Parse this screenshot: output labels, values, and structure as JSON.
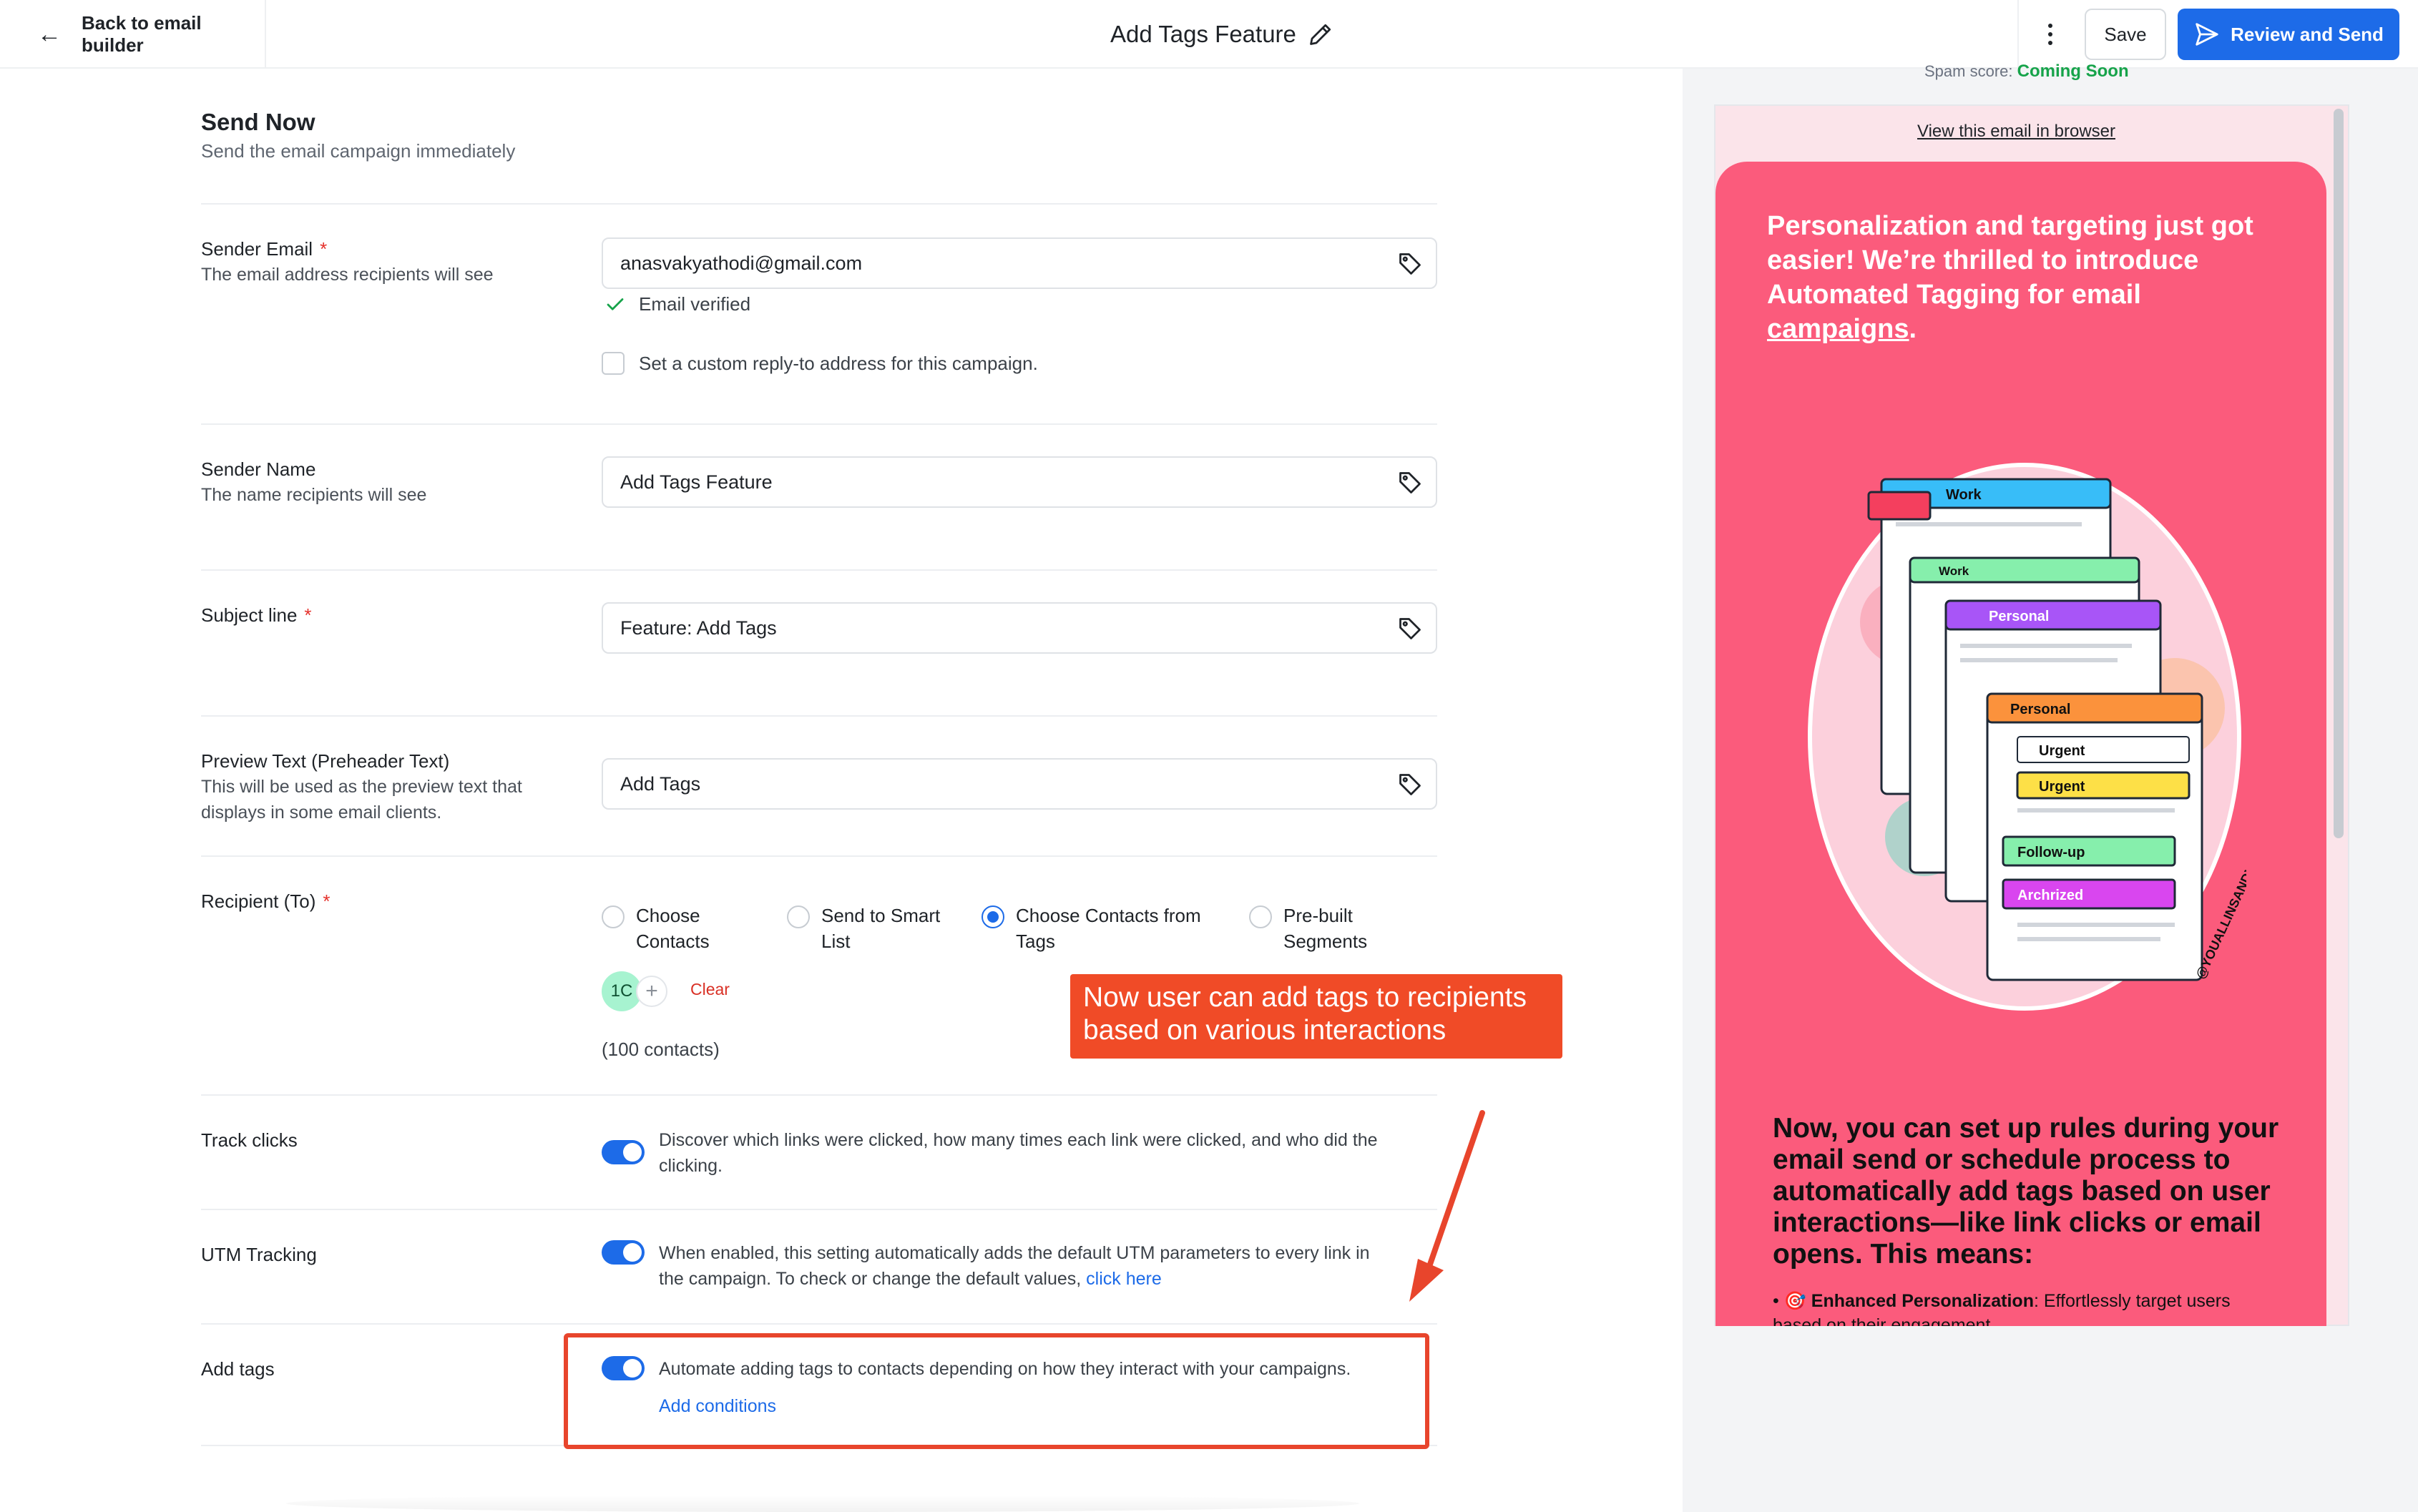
{
  "topbar": {
    "back_label": "Back to email builder",
    "title": "Add Tags Feature",
    "save_label": "Save",
    "review_label": "Review and Send"
  },
  "send_now": {
    "title": "Send Now",
    "subtitle": "Send the email campaign immediately"
  },
  "sender_email": {
    "label": "Sender Email",
    "required_mark": "*",
    "help": "The email address recipients will see",
    "value": "anasvakyathodi@gmail.com",
    "verified_text": "Email verified",
    "reply_to_label": "Set a custom reply-to address for this campaign."
  },
  "sender_name": {
    "label": "Sender Name",
    "help": "The name recipients will see",
    "value": "Add Tags Feature"
  },
  "subject": {
    "label": "Subject line",
    "required_mark": "*",
    "value": "Feature: Add Tags"
  },
  "preview_text": {
    "label": "Preview Text (Preheader Text)",
    "help_line1": "This will be used as the preview text that",
    "help_line2": "displays in some email clients.",
    "value": "Add Tags"
  },
  "recipient": {
    "label": "Recipient (To)",
    "required_mark": "*",
    "options": [
      {
        "line1": "Choose",
        "line2": "Contacts",
        "selected": false
      },
      {
        "line1": "Send to Smart",
        "line2": "List",
        "selected": false
      },
      {
        "line1": "Choose Contacts from",
        "line2": "Tags",
        "selected": true
      },
      {
        "line1": "Pre-built",
        "line2": "Segments",
        "selected": false
      }
    ],
    "chip": "1C",
    "add_symbol": "+",
    "clear_label": "Clear",
    "count": "(100 contacts)"
  },
  "track_clicks": {
    "label": "Track clicks",
    "enabled": true,
    "desc_line1": "Discover which links were clicked, how many times each link were clicked, and who did the",
    "desc_line2": "clicking."
  },
  "utm": {
    "label": "UTM Tracking",
    "enabled": true,
    "desc_line1": "When enabled, this setting automatically adds the default UTM parameters to every link in",
    "desc_line2": "the campaign. To check or change the default values,",
    "link": "click here"
  },
  "add_tags": {
    "label": "Add tags",
    "enabled": true,
    "desc": "Automate adding tags to contacts depending on how they interact with your campaigns.",
    "link": "Add conditions"
  },
  "annotation": {
    "line1": "Now user can add tags to recipients",
    "line2": "based on various interactions"
  },
  "preview": {
    "spam_label": "Spam score:",
    "spam_value": "Coming Soon",
    "view_in_browser": "View this email in browser",
    "headline_line1": "Personalization and targeting just got",
    "headline_line2": "easier! We’re thrilled to introduce",
    "headline_line3": "Automated Tagging for email",
    "headline_link": "campaigns",
    "headline_end": ".",
    "body_line1": "Now, you can set up rules during your",
    "body_line2": "email send or schedule process to",
    "body_line3": "automatically add tags based on user",
    "body_line4": "interactions—like link clicks or email",
    "body_line5": "opens. This means:",
    "bullet_prefix": "• 🎯",
    "bullet_bold": "Enhanced Personalization",
    "bullet_text": ": Effortlessly target users",
    "bullet_text2": "based on their engagement",
    "illustration": {
      "cards": [
        "Work",
        "Work",
        "Personal",
        "Personal"
      ],
      "tags": [
        "Urgent",
        "Urgent",
        "Follow-up",
        "Archrized"
      ],
      "watermark": "@YOUALLINSANDYS.COM"
    }
  },
  "colors": {
    "accent": "#1d6be8",
    "required": "#e5312b",
    "annotation": "#f04b27",
    "preview_card": "#fb5b7c"
  }
}
